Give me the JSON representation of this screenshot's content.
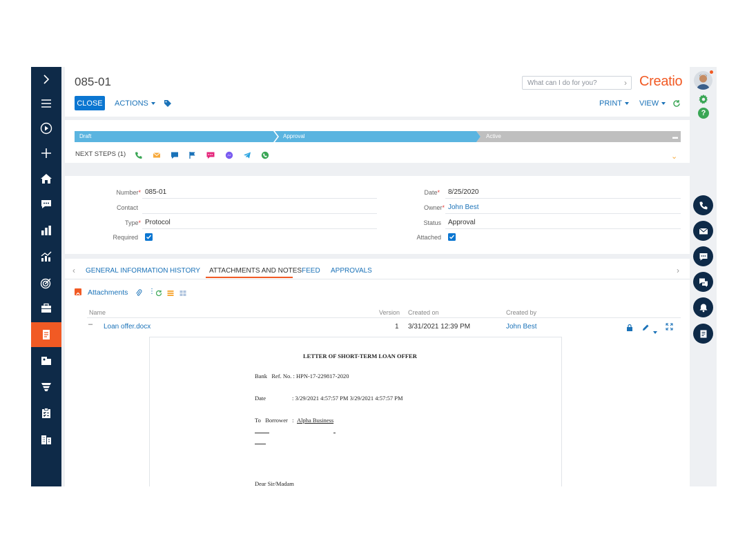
{
  "record": {
    "title": "085-01",
    "close_label": "CLOSE",
    "actions_label": "ACTIONS",
    "print_label": "PRINT",
    "view_label": "VIEW"
  },
  "search": {
    "placeholder": "What can I do for you?"
  },
  "brand": {
    "logo_text": "Creatio",
    "accent": "#f15a24",
    "primary": "#0b76d1",
    "nav_bg": "#0e2a48"
  },
  "stages": [
    {
      "label": "Draft",
      "color": "#5ab4e0"
    },
    {
      "label": "Approval",
      "color": "#5ab4e0"
    },
    {
      "label": "Active",
      "color": "#bfbfbf"
    }
  ],
  "next_steps": {
    "label": "NEXT STEPS (1)",
    "icons": [
      "phone-icon",
      "email-icon",
      "chat-icon",
      "flag-icon",
      "sms-icon",
      "messenger-icon",
      "telegram-icon",
      "whatsapp-icon"
    ]
  },
  "fields": {
    "number": {
      "label": "Number",
      "value": "085-01",
      "required": true
    },
    "contact": {
      "label": "Contact",
      "value": ""
    },
    "type": {
      "label": "Type",
      "value": "Protocol",
      "required": true
    },
    "required_flag": {
      "label": "Required",
      "checked": true
    },
    "date": {
      "label": "Date",
      "value": "8/25/2020",
      "required": true
    },
    "owner": {
      "label": "Owner",
      "value": "John Best",
      "required": true
    },
    "status": {
      "label": "Status",
      "value": "Approval"
    },
    "attached_flag": {
      "label": "Attached",
      "checked": true
    }
  },
  "tabs": [
    {
      "label": "GENERAL INFORMATION"
    },
    {
      "label": "HISTORY"
    },
    {
      "label": "ATTACHMENTS AND NOTES",
      "active": true
    },
    {
      "label": "FEED"
    },
    {
      "label": "APPROVALS"
    }
  ],
  "attachments": {
    "title": "Attachments",
    "columns": [
      "Name",
      "Version",
      "Created on",
      "Created by"
    ],
    "rows": [
      {
        "name": "Loan offer.docx",
        "version": "1",
        "created_on": "3/31/2021 12:39 PM",
        "created_by": "John Best"
      }
    ]
  },
  "document": {
    "heading": "LETTER OF SHORT-TERM LOAN OFFER",
    "ref": "Bank   Ref. No. : HPN-17-229817-2020",
    "date_label": "Date",
    "date_value": ": 3/29/2021 4:57:57 PM 3/29/2021 4:57:57 PM",
    "to_label": "To   Borrower   :",
    "to_value": "Alpha Business",
    "salutation": "Dear Sir/Madam"
  }
}
